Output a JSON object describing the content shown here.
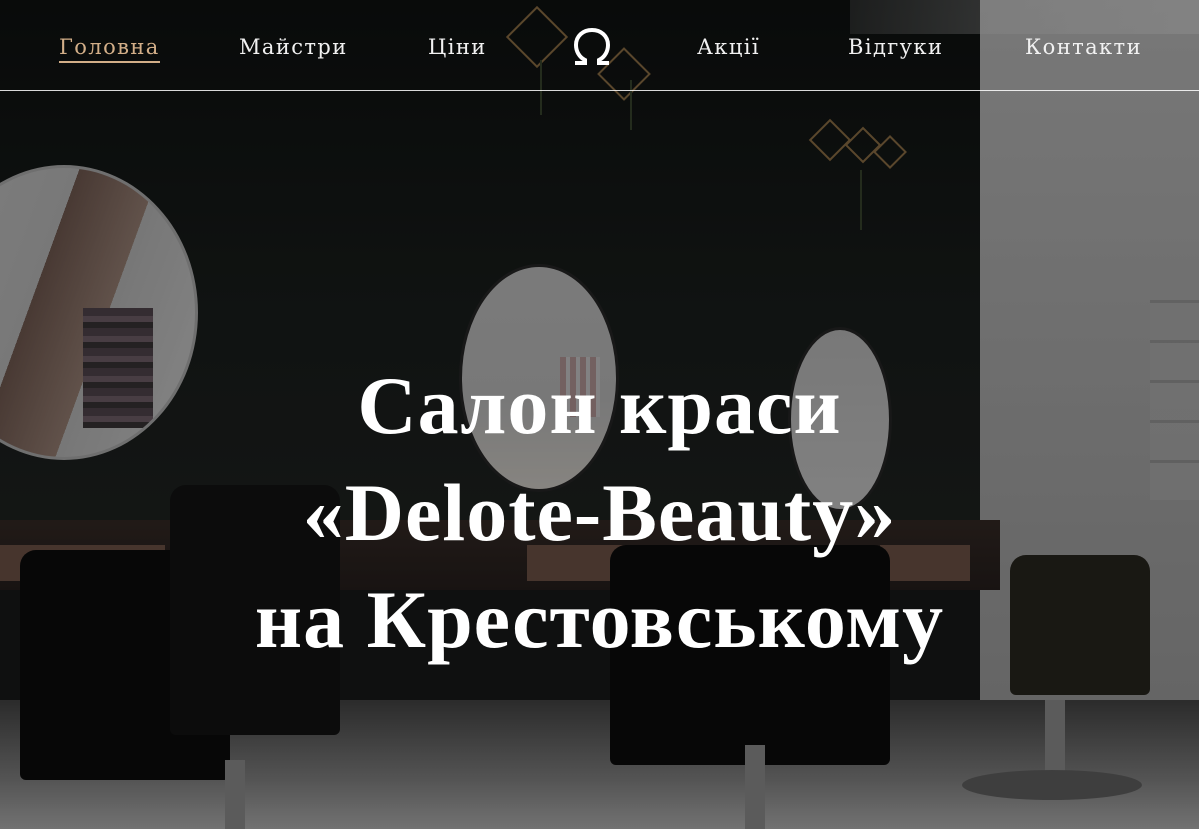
{
  "nav": {
    "items": [
      {
        "label": "Головна",
        "active": true
      },
      {
        "label": "Майстри",
        "active": false
      },
      {
        "label": "Ціни",
        "active": false
      },
      {
        "label": "Акції",
        "active": false
      },
      {
        "label": "Відгуки",
        "active": false
      },
      {
        "label": "Контакти",
        "active": false
      }
    ],
    "logo_icon": "omega-logo-icon"
  },
  "hero": {
    "title_lines": [
      "Салон краси",
      "«Delote-Beauty»",
      "на Крестовському"
    ],
    "background": "beauty-salon-interior-photo"
  },
  "colors": {
    "accent": "#d2ae88",
    "text": "#ffffff",
    "nav_divider": "#ffffff"
  }
}
